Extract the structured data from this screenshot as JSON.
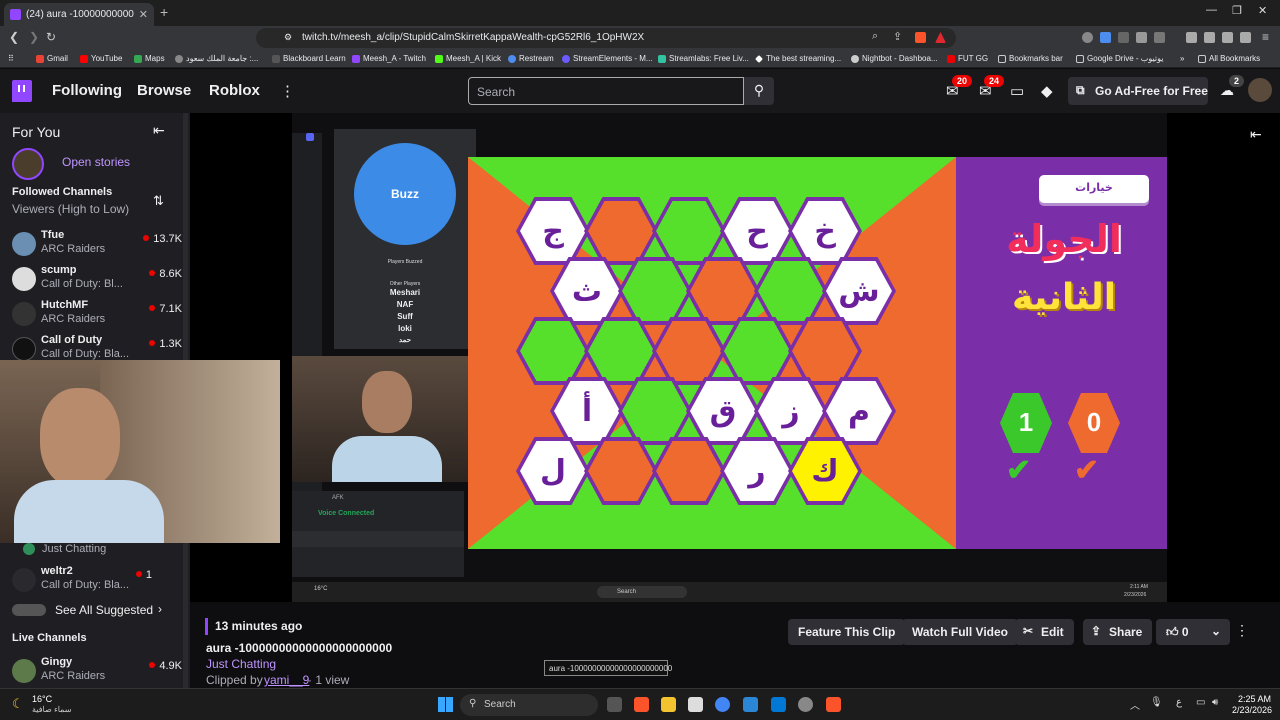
{
  "browser": {
    "tab_title": "(24) aura -10000000000000...",
    "url": "twitch.tv/meesh_a/clip/StupidCalmSkirretKappaWealth-cpG52Rl6_1OpHW2X",
    "bookmarks": [
      "Gmail",
      "YouTube",
      "Maps",
      "جامعة الملك سعود :...",
      "Blackboard Learn",
      "Meesh_A - Twitch",
      "Meesh_A | Kick",
      "Restream",
      "StreamElements - M...",
      "Streamlabs: Free Liv...",
      "The best streaming...",
      "Nightbot - Dashboa...",
      "FUT GG",
      "Bookmarks bar",
      "Google Drive - يوتيوب",
      "All Bookmarks"
    ]
  },
  "topnav": {
    "links": [
      "Following",
      "Browse",
      "Roblox"
    ],
    "search_placeholder": "Search",
    "badge1": "20",
    "badge2": "24",
    "adfree": "Go Ad-Free for Free",
    "avatar_badge": "2"
  },
  "sidebar": {
    "for_you": "For You",
    "open_stories": "Open stories",
    "followed": "Followed Channels",
    "sort": "Viewers (High to Low)",
    "channels": [
      {
        "name": "Tfue",
        "game": "ARC Raiders",
        "viewers": "13.7K"
      },
      {
        "name": "scump",
        "game": "Call of Duty: Bl...",
        "viewers": "8.6K"
      },
      {
        "name": "HutchMF",
        "game": "ARC Raiders",
        "viewers": "7.1K"
      },
      {
        "name": "Call of Duty",
        "game": "Call of Duty: Bla...",
        "viewers": "1.3K"
      }
    ],
    "just_chatting": "Just Chatting",
    "weltr2": {
      "name": "weltr2",
      "game": "Call of Duty: Bla...",
      "viewers": "1"
    },
    "see_all": "See All Suggested",
    "live_channels": "Live Channels",
    "gingy": {
      "name": "Gingy",
      "game": "ARC Raiders",
      "viewers": "4.9K"
    }
  },
  "video": {
    "buzz": "Buzz",
    "players_buzzed": "Players Buzzed",
    "other_players": "Other Players",
    "players": [
      "Meshari",
      "NAF",
      "Suff",
      "loki",
      "حمد"
    ],
    "options_btn": "خيارات",
    "round_text_1": "الجولة",
    "round_text_2": "الثانية",
    "score_green": "1",
    "score_orange": "0",
    "hex_letters": [
      "ج",
      "ح",
      "خ",
      "ث",
      "ش",
      "أ",
      "ق",
      "ز",
      "م",
      "ل",
      "ر",
      "ك"
    ],
    "voice_connected": "Voice Connected",
    "afk": "AFK",
    "inner_search": "Search",
    "inner_time": "2:11 AM",
    "inner_date": "2/23/2026",
    "inner_temp": "16°C"
  },
  "info": {
    "time_ago": "13 minutes ago",
    "title": "aura -10000000000000000000000",
    "category": "Just Chatting",
    "clipped_by_label": "Clipped by",
    "clipper": "yami__9",
    "views": "· 1 view",
    "tooltip": "aura -10000000000000000000000",
    "buttons": [
      "Feature This Clip",
      "Watch Full Video",
      "Edit",
      "Share"
    ],
    "likes": "0"
  },
  "taskbar": {
    "weather_temp": "16°C",
    "weather_desc": "سماء صافية",
    "search": "Search",
    "time": "2:25 AM",
    "date": "2/23/2026"
  }
}
